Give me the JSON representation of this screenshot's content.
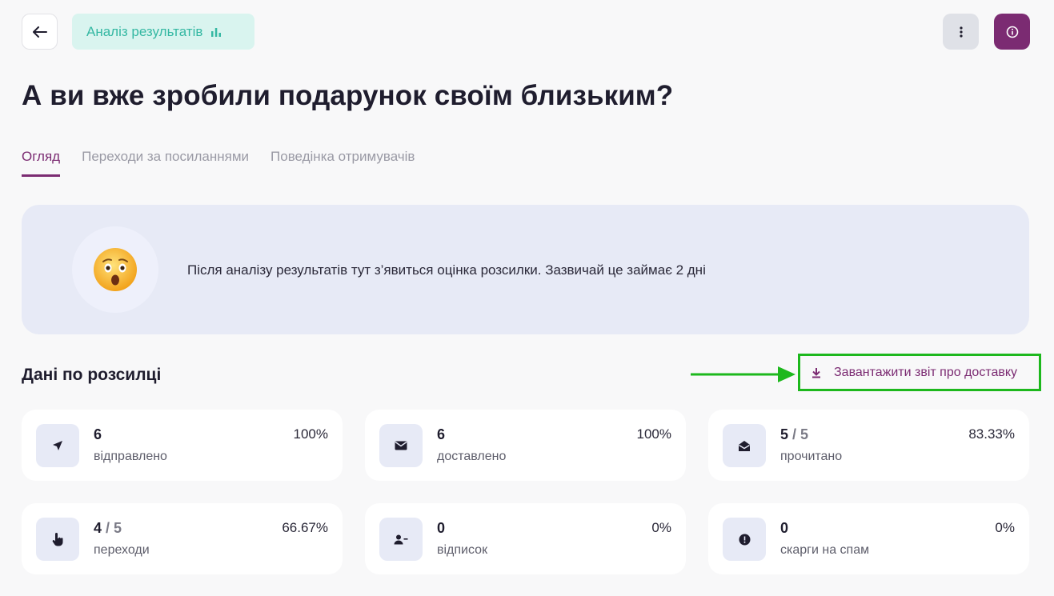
{
  "header": {
    "status_label": "Аналіз результатів",
    "status_icon": "bar-chart-icon",
    "back_icon": "arrow-left-icon",
    "menu_icon": "more-vertical-icon",
    "info_icon": "info-icon"
  },
  "page_title": "А ви вже зробили подарунок своїм близьким?",
  "tabs": [
    {
      "label": "Огляд",
      "active": true
    },
    {
      "label": "Переходи за посиланнями",
      "active": false
    },
    {
      "label": "Поведінка отримувачів",
      "active": false
    }
  ],
  "banner": {
    "emoji": "😲",
    "text": "Після аналізу результатів тут з’явиться оцінка розсилки. Зазвичай це займає 2 дні"
  },
  "section": {
    "title": "Дані по розсилці",
    "download_label": "Завантажити звіт про доставку",
    "download_icon": "download-icon"
  },
  "stats": [
    {
      "value": "6",
      "total": "",
      "label": "відправлено",
      "pct": "100%",
      "icon": "send-icon"
    },
    {
      "value": "6",
      "total": "",
      "label": "доставлено",
      "pct": "100%",
      "icon": "envelope-icon"
    },
    {
      "value": "5",
      "total": "5",
      "label": "прочитано",
      "pct": "83.33%",
      "icon": "envelope-open-icon"
    },
    {
      "value": "4",
      "total": "5",
      "label": "переходи",
      "pct": "66.67%",
      "icon": "pointer-hand-icon"
    },
    {
      "value": "0",
      "total": "",
      "label": "відписок",
      "pct": "0%",
      "icon": "user-minus-icon"
    },
    {
      "value": "0",
      "total": "",
      "label": "скарги на спам",
      "pct": "0%",
      "icon": "alert-circle-icon"
    }
  ],
  "colors": {
    "accent": "#7b2b72",
    "status_bg": "#d9f4ef",
    "status_text": "#35b8a3",
    "highlight": "#1db81d",
    "banner_bg": "#e7eaf6"
  }
}
